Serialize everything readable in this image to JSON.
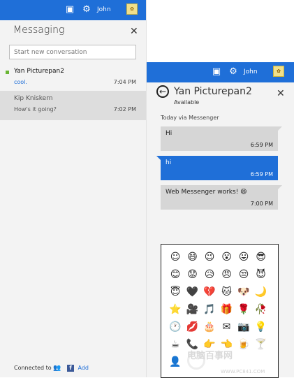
{
  "left_panel": {
    "topbar": {
      "user": "John"
    },
    "title": "Messaging",
    "search": {
      "placeholder": "Start new conversation"
    },
    "conversations": [
      {
        "name": "Yan Picturepan2",
        "message": "cool.",
        "time": "7:04 PM",
        "unread": true
      },
      {
        "name": "Kip Kniskern",
        "message": "How's it going?",
        "time": "7:02 PM",
        "unread": false
      }
    ],
    "footer": {
      "connected_label": "Connected to",
      "add_label": "Add"
    }
  },
  "right_panel": {
    "topbar": {
      "user": "John"
    },
    "contact_name": "Yan Picturepan2",
    "status": "Available",
    "day_label": "Today via Messenger",
    "messages": [
      {
        "text": "Hi",
        "time": "6:59 PM",
        "direction": "in"
      },
      {
        "text": "hi",
        "time": "6:59 PM",
        "direction": "out"
      },
      {
        "text": "Web Messenger works! 😄",
        "time": "7:00 PM",
        "direction": "in"
      }
    ]
  },
  "emoji_picker": {
    "rows": [
      [
        "☺",
        "😄",
        "😉",
        "😮",
        "😛",
        "😎"
      ],
      [
        "😊",
        "😟",
        "😥",
        "😠",
        "😒",
        "😈"
      ],
      [
        "😇",
        "🖤",
        "💔",
        "🐱",
        "🐶",
        "🌙"
      ],
      [
        "⭐",
        "🎥",
        "🎵",
        "🎁",
        "🌹",
        "🥀"
      ],
      [
        "🕐",
        "💋",
        "🎂",
        "✉",
        "📷",
        "💡"
      ],
      [
        "☕",
        "📞",
        "👉",
        "👈",
        "🍺",
        "🍸"
      ],
      [
        "👤",
        "",
        "",
        "",
        "",
        ""
      ]
    ]
  },
  "watermark": {
    "text": "电脑百事网",
    "sub": "WWW.PC841.COM"
  },
  "colors": {
    "accent": "#1f6fd8",
    "unread": "#69b533",
    "bubble_in": "#d6d6d6"
  }
}
